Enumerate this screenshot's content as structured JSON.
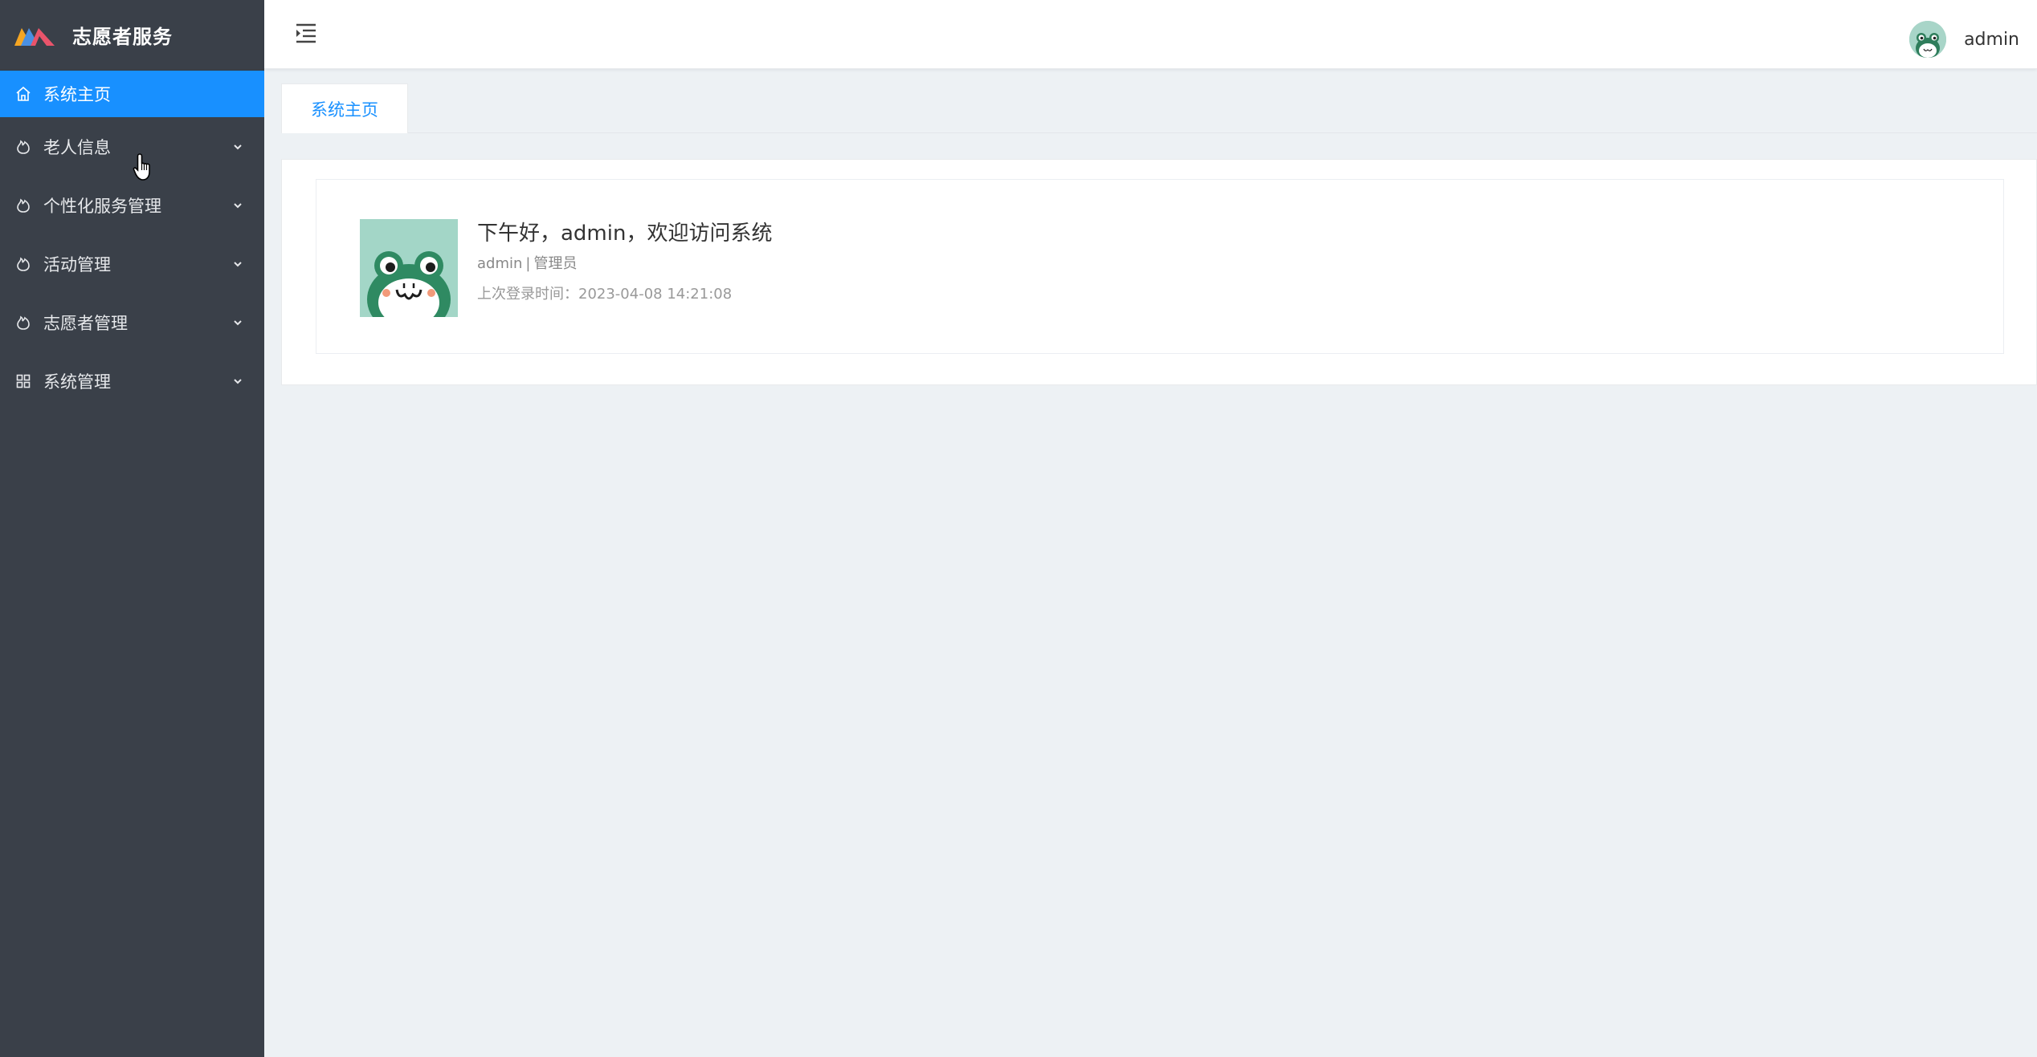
{
  "app": {
    "title": "志愿者服务"
  },
  "sidebar": {
    "items": [
      {
        "label": "系统主页",
        "icon": "home-icon",
        "active": true
      },
      {
        "label": "老人信息",
        "icon": "flame-icon"
      },
      {
        "label": "个性化服务管理",
        "icon": "flame-icon"
      },
      {
        "label": "活动管理",
        "icon": "flame-icon"
      },
      {
        "label": "志愿者管理",
        "icon": "flame-icon"
      },
      {
        "label": "系统管理",
        "icon": "grid-icon"
      }
    ]
  },
  "header": {
    "user_name": "admin"
  },
  "tags": {
    "active_label": "系统主页"
  },
  "welcome": {
    "greeting": "下午好，admin，欢迎访问系统",
    "username": "admin",
    "separator": "|",
    "role": "管理员",
    "last_login_label": "上次登录时间：",
    "last_login_time": "2023-04-08 14:21:08"
  },
  "colors": {
    "sidebar_bg": "#3a4049",
    "accent": "#1890ff",
    "page_bg": "#edf1f4"
  }
}
